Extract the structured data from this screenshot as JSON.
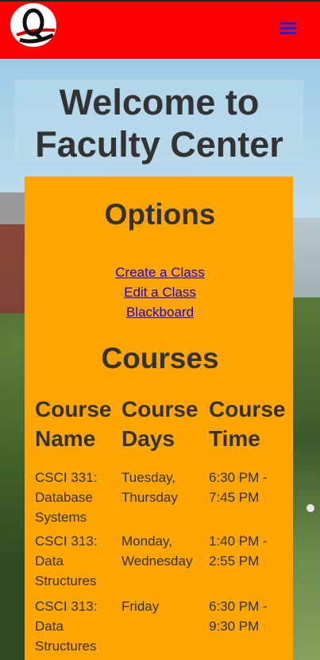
{
  "header": {
    "menu_icon": "hamburger-menu-icon",
    "brand_color": "#ff0000"
  },
  "welcome": {
    "line1": "Welcome to",
    "line2": "Faculty Center"
  },
  "options": {
    "title": "Options",
    "links": [
      "Create a Class",
      "Edit a Class",
      "Blackboard"
    ]
  },
  "courses": {
    "title": "Courses",
    "headers": [
      [
        "Course",
        "Name"
      ],
      [
        "Course",
        "Days"
      ],
      [
        "Course",
        "Time"
      ]
    ],
    "rows": [
      {
        "name": [
          "CSCI 331:",
          "Database",
          "Systems"
        ],
        "days": [
          "Tuesday,",
          "Thursday"
        ],
        "time": [
          "6:30 PM -",
          "7:45 PM"
        ]
      },
      {
        "name": [
          "CSCI 313:",
          "Data",
          "Structures"
        ],
        "days": [
          "Monday,",
          "Wednesday"
        ],
        "time": [
          "1:40 PM -",
          "2:55 PM"
        ]
      },
      {
        "name": [
          "CSCI 313:",
          "Data",
          "Structures"
        ],
        "days": [
          "Friday"
        ],
        "time": [
          "6:30 PM -",
          "9:30 PM"
        ]
      }
    ]
  },
  "colors": {
    "panel": "#ffa500",
    "heading_text": "#333333",
    "link": "#2200cc"
  }
}
